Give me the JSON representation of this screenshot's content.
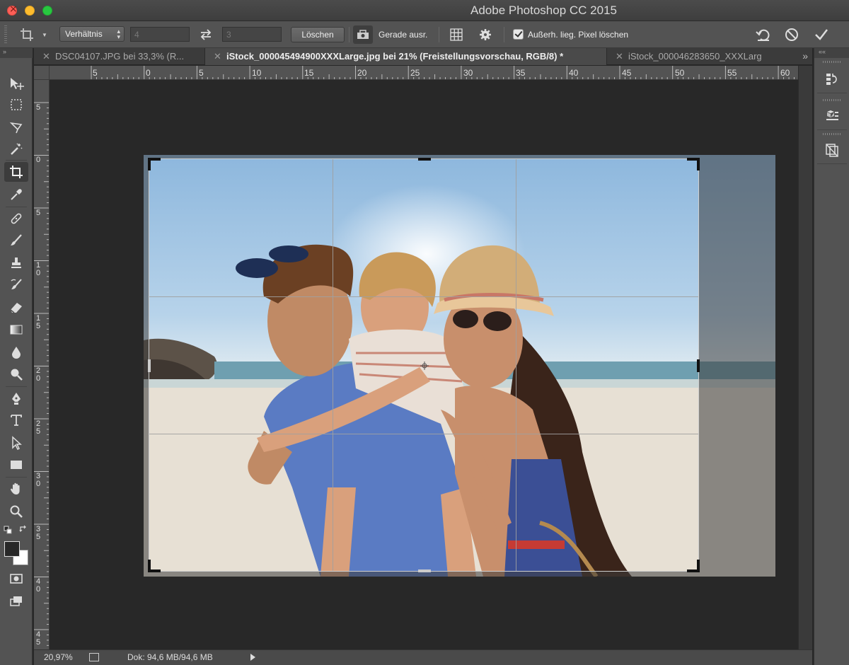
{
  "window": {
    "title": "Adobe Photoshop CC 2015"
  },
  "options": {
    "preset": "Verhältnis",
    "width_value": "4",
    "height_value": "3",
    "clear_label": "Löschen",
    "straighten_label": "Gerade ausr.",
    "delete_cropped_label": "Außerh. lieg. Pixel löschen",
    "delete_cropped_checked": true
  },
  "tabs": [
    {
      "label": "DSC04107.JPG bei 33,3% (R...",
      "active": false
    },
    {
      "label": "iStock_000045494900XXXLarge.jpg bei 21% (Freistellungsvorschau, RGB/8) *",
      "active": true
    },
    {
      "label": "iStock_000046283650_XXXLarg",
      "active": false
    }
  ],
  "ruler": {
    "h_ticks": [
      "5",
      "0",
      "5",
      "10",
      "15",
      "20",
      "25",
      "30",
      "35",
      "40",
      "45",
      "50",
      "55",
      "60"
    ],
    "v_ticks": [
      "5",
      "0",
      "5",
      "10",
      "15",
      "20",
      "25",
      "30",
      "35",
      "40",
      "45"
    ]
  },
  "tools": [
    "move-tool",
    "marquee-tool",
    "lasso-tool",
    "magic-wand-tool",
    "crop-tool",
    "eyedropper-tool",
    "healing-brush-tool",
    "brush-tool",
    "clone-stamp-tool",
    "history-brush-tool",
    "eraser-tool",
    "gradient-tool",
    "blur-tool",
    "dodge-tool",
    "pen-tool",
    "type-tool",
    "path-selection-tool",
    "rectangle-tool",
    "hand-tool",
    "zoom-tool"
  ],
  "status": {
    "zoom": "20,97%",
    "doc": "Dok: 94,6 MB/94,6 MB"
  },
  "colors": {
    "accent_bg": "#535353",
    "canvas": "#282828",
    "fg_swatch": "#282828",
    "bg_swatch": "#ffffff"
  }
}
